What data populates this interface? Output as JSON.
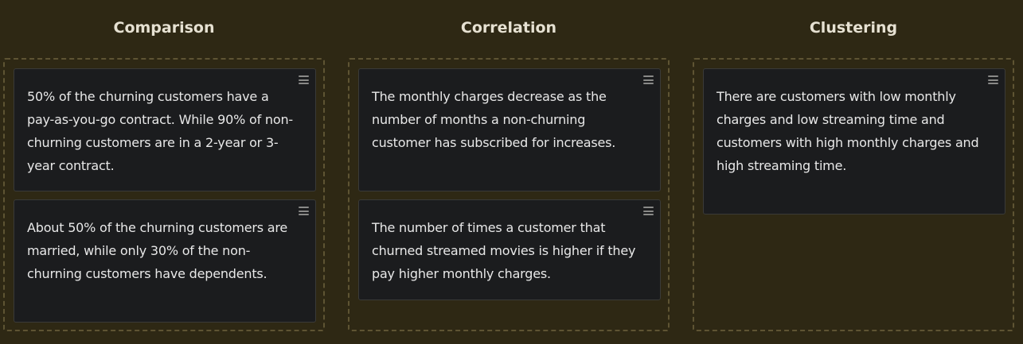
{
  "columns": [
    {
      "title": "Comparison",
      "cards": [
        {
          "text": "50% of the churning customers have a pay-as-you-go contract. While 90% of non-churning customers are in a 2-year or 3-year contract."
        },
        {
          "text": "About 50% of the churning customers are married, while only 30% of the non-churning customers have dependents."
        }
      ]
    },
    {
      "title": "Correlation",
      "cards": [
        {
          "text": "The monthly charges decrease as the number of months a non-churning customer has subscribed for increases."
        },
        {
          "text": "The number of times a customer that churned streamed movies is higher if they pay higher monthly charges."
        }
      ]
    },
    {
      "title": "Clustering",
      "cards": [
        {
          "text": "There are customers with low monthly charges and low streaming time and customers with high monthly charges and high streaming time."
        }
      ]
    }
  ],
  "icons": {
    "drag_handle": "hamburger-drag-icon"
  },
  "colors": {
    "background": "#2e2814",
    "card_background": "#1b1c1e",
    "dashed_border": "#5e5433",
    "header_text": "#e6e1d2",
    "card_text": "#e8e8e8"
  }
}
